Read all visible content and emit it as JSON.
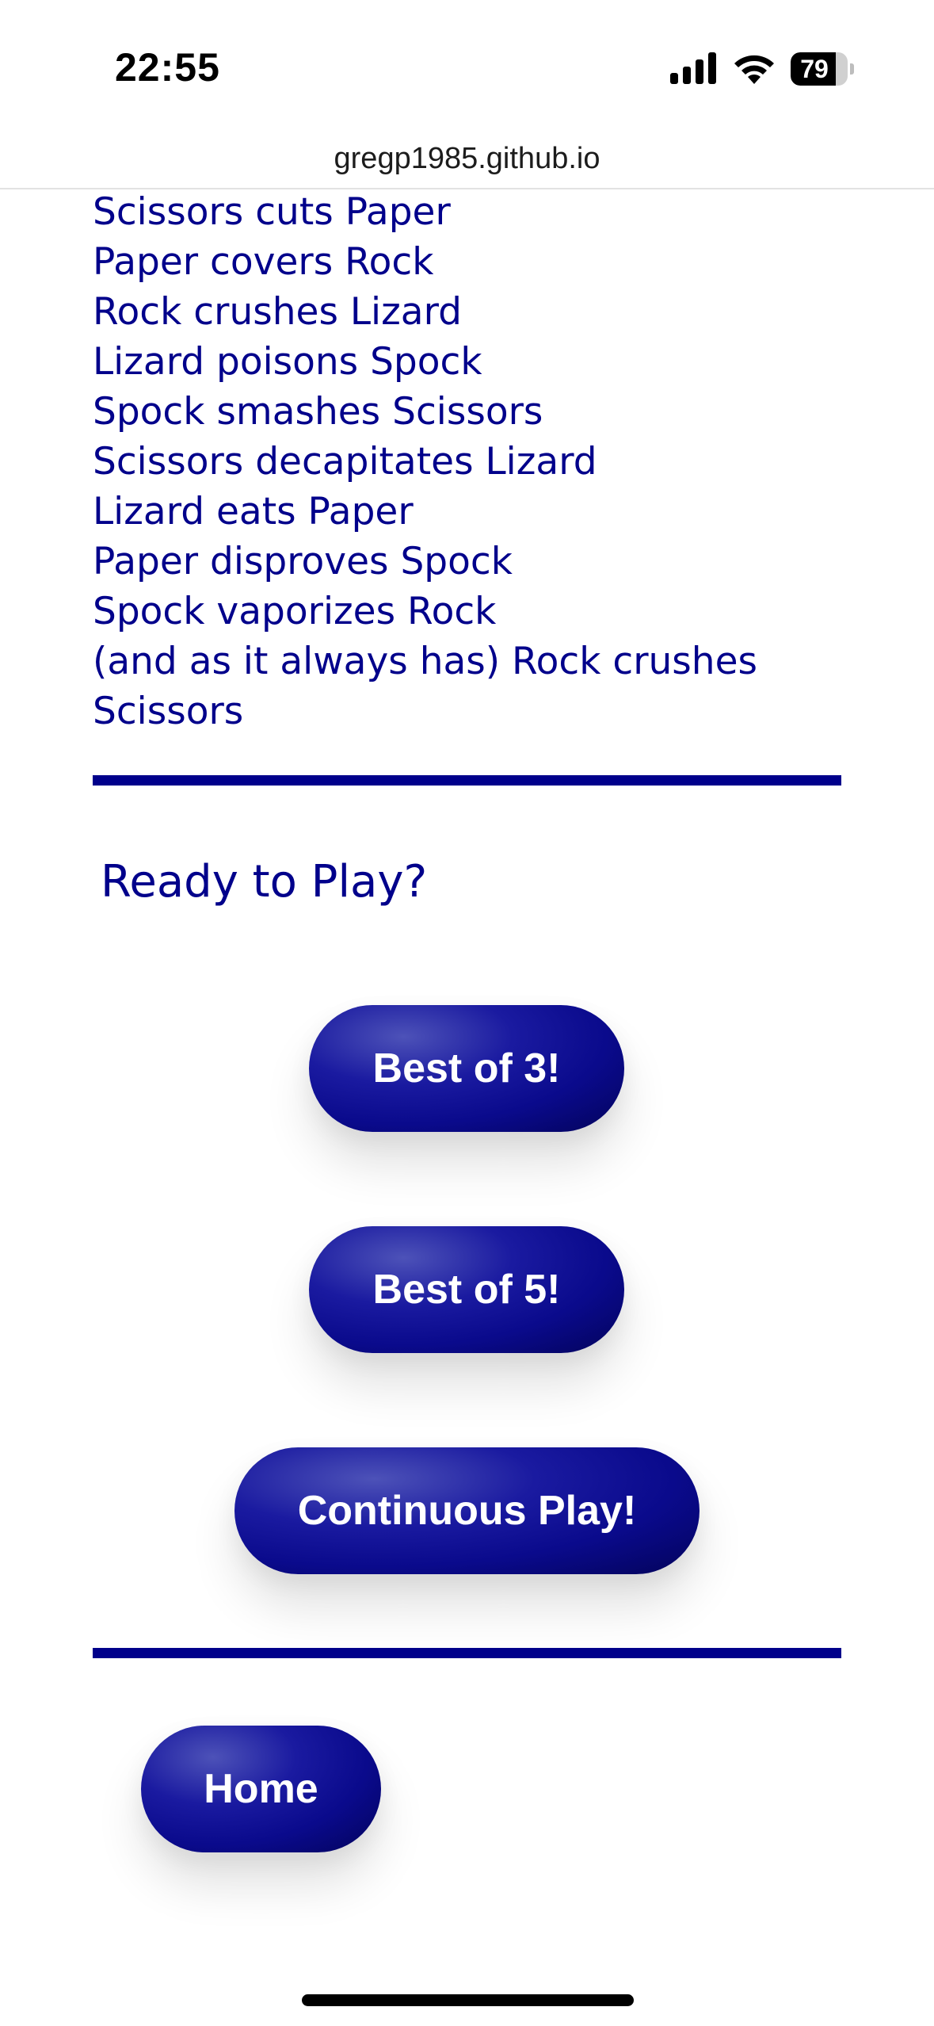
{
  "status_bar": {
    "time": "22:55",
    "signal_icon": "cellular-signal-icon",
    "wifi_icon": "wifi-icon",
    "battery_level": "79",
    "battery_fraction": 0.79
  },
  "browser": {
    "url": "gregp1985.github.io"
  },
  "rules": [
    "Scissors cuts Paper",
    "Paper covers Rock",
    "Rock crushes Lizard",
    "Lizard poisons Spock",
    "Spock smashes Scissors",
    "Scissors decapitates Lizard",
    "Lizard eats Paper",
    "Paper disproves Spock",
    "Spock vaporizes Rock",
    "(and as it always has) Rock crushes",
    "Scissors"
  ],
  "play": {
    "heading": "Ready to Play?",
    "best_of_3": "Best of 3!",
    "best_of_5": "Best of 5!",
    "continuous": "Continuous Play!"
  },
  "nav": {
    "home": "Home"
  },
  "colors": {
    "accent": "#00008b",
    "text_on_button": "#ffffff"
  }
}
